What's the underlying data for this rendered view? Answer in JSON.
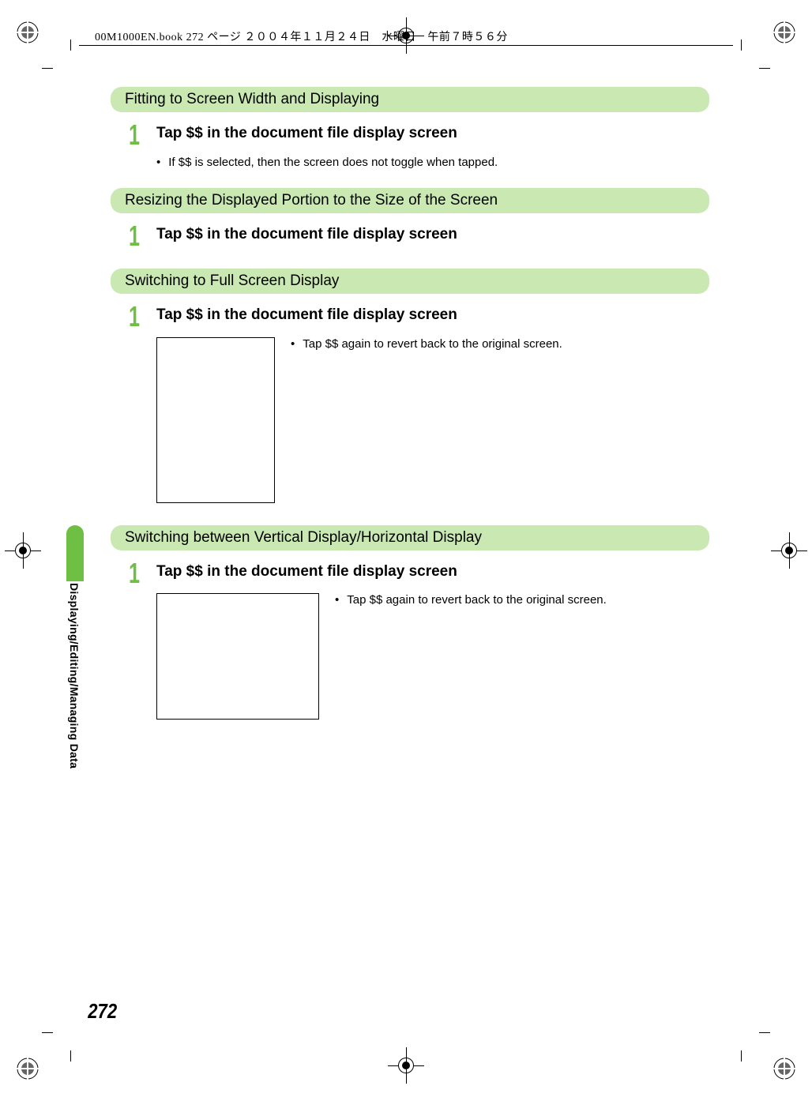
{
  "header": "00M1000EN.book  272 ページ  ２００４年１１月２４日　水曜日　午前７時５６分",
  "side_label": "Displaying/Editing/Managing Data",
  "page_number": "272",
  "sections": [
    {
      "title": "Fitting to Screen Width and Displaying",
      "step_num": "1",
      "step_title": "Tap $$ in the document file display screen",
      "bullet": "If $$ is selected, then the screen does not toggle when tapped.",
      "has_image": false
    },
    {
      "title": "Resizing the Displayed Portion to the Size of the Screen",
      "step_num": "1",
      "step_title": "Tap $$ in the document file display screen",
      "bullet": null,
      "has_image": false
    },
    {
      "title": "Switching to Full Screen Display",
      "step_num": "1",
      "step_title": "Tap $$ in the document file display screen",
      "bullet": null,
      "has_image": true,
      "image_wide": false,
      "image_bullet": "Tap $$ again to revert back to the original screen."
    },
    {
      "title": "Switching between Vertical Display/Horizontal Display",
      "step_num": "1",
      "step_title": "Tap $$ in the document file display screen",
      "bullet": null,
      "has_image": true,
      "image_wide": true,
      "image_bullet": "Tap $$ again to revert back to the original screen."
    }
  ]
}
